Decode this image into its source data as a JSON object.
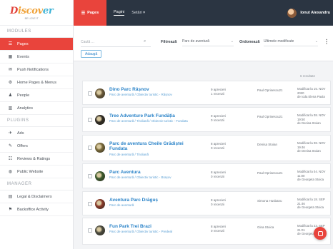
{
  "sidebar": {
    "logo": {
      "part1": "D",
      "part2": "iscov",
      "part3": "er",
      "tagline": "BE LOVE IT"
    },
    "sections": [
      {
        "title": "MODULES",
        "items": [
          {
            "label": "Pages",
            "icon": "list-icon",
            "active": true
          },
          {
            "label": "Events",
            "icon": "calendar-icon"
          },
          {
            "label": "Push Notifications",
            "icon": "envelope-icon"
          },
          {
            "label": "Home Pages & Menus",
            "icon": "gear-icon"
          },
          {
            "label": "People",
            "icon": "user-icon"
          },
          {
            "label": "Analytics",
            "icon": "chart-icon"
          }
        ]
      },
      {
        "title": "PLUGINS",
        "items": [
          {
            "label": "Ads",
            "icon": "megaphone-icon"
          },
          {
            "label": "Offers",
            "icon": "tag-icon"
          },
          {
            "label": "Reviews & Ratings",
            "icon": "reviews-icon"
          },
          {
            "label": "Public Website",
            "icon": "globe-icon"
          }
        ]
      },
      {
        "title": "MANAGER",
        "items": [
          {
            "label": "Legal & Disclaimers",
            "icon": "document-icon"
          },
          {
            "label": "Backoffice Activity",
            "icon": "activity-icon"
          }
        ]
      }
    ]
  },
  "topbar": {
    "brand_label": "Pages",
    "links": [
      "Pagini",
      "Setări ▾"
    ],
    "user_name": "Ionut Alexandru"
  },
  "filters": {
    "search_placeholder": "Caută ...",
    "filter_label": "Filtrează",
    "filter_value": "Parc de aventură",
    "sort_label": "Ordonează",
    "sort_value": "Ultimele modificate",
    "add_button": "Adaugă"
  },
  "results_count": "6 rezultate",
  "pages": [
    {
      "title": "Dino Parc Râșnov",
      "categories": "Parc de aventură / Obiectiv turistic - Râșnov",
      "ratings": "9 aprecieri",
      "reviews": "1 recenzii",
      "author": "Paul Oprisescu21",
      "modified": "Modificat la 15. NOV 2020",
      "modified_by": "de Ioda Elena Paula",
      "thumb_color": "#6b5a3a"
    },
    {
      "title": "Tree Adventure Park Fundăția",
      "categories": "Parc de aventură / Tirolianã / Obiectiv turistic - Fundata",
      "ratings": "9 aprecieri",
      "reviews": "0 recenzii",
      "author": "Paul Oprisescu21",
      "modified": "Modificat la 08. NOV 19:50",
      "modified_by": "de Denisa Stoian",
      "thumb_color": "#2f2a22"
    },
    {
      "title": "Parc de aventura Cheile Grădiștei Fundata",
      "categories": "Parc de aventură / Tirolianã",
      "ratings": "8 aprecieri",
      "reviews": "0 recenzii",
      "author": "Denisa Stoian",
      "modified": "Modificat la 08. NOV 19:46",
      "modified_by": "de Denisa Stoian",
      "thumb_color": "#7a6a3a"
    },
    {
      "title": "Parc Aventura",
      "categories": "Parc de aventură / Obiectiv turistic - Brașov",
      "ratings": "8 aprecieri",
      "reviews": "0 recenzii",
      "author": "Paul Oprisescu21",
      "modified": "Modificat la 04. NOV 11:00",
      "modified_by": "de Georgeta Stoica",
      "thumb_color": "#3c5a2c"
    },
    {
      "title": "Aventura Parc Drăguș",
      "categories": "Parc de aventură",
      "ratings": "8 aprecieri",
      "reviews": "0 recenzii",
      "author": "Simona Husbanu",
      "modified": "Modificat la 18. SEP 21:46",
      "modified_by": "de Georgeta Stoica",
      "thumb_color": "#8a3a2a"
    },
    {
      "title": "Fun Park Trei Brazi",
      "categories": "Parc de aventură / Obiectiv turistic - Predeal",
      "ratings": "8 aprecieri",
      "reviews": "0 recenzii",
      "author": "Gina Stoica",
      "modified": "Modificat la 23. SEP 21:01",
      "modified_by": "de Georgeta Stoica",
      "thumb_color": "#4a4a3e"
    }
  ],
  "colors": {
    "accent": "#e9443c",
    "topbar": "#2b3542",
    "link": "#2a83c8"
  }
}
